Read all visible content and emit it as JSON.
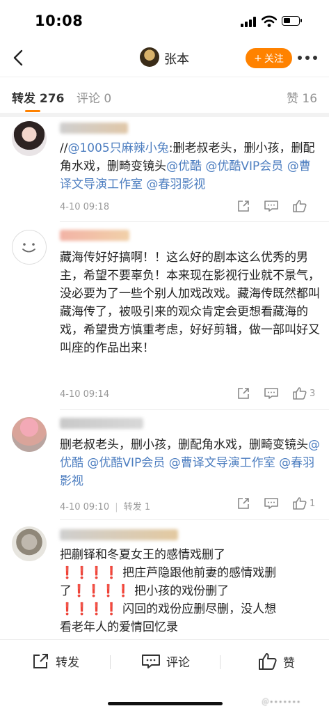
{
  "status": {
    "time": "10:08"
  },
  "nav": {
    "title": "张本",
    "follow_label": "关注"
  },
  "tabs": {
    "repost": "转发 276",
    "comment": "评论 0",
    "like": "赞 16"
  },
  "comments": [
    {
      "text_parts": [
        {
          "t": "//",
          "link": false
        },
        {
          "t": "@1005只麻辣小兔",
          "link": true
        },
        {
          "t": ":删老叔老头，删小孩，删配角水戏，删畸变镜头",
          "link": false
        },
        {
          "t": "@优酷",
          "link": true
        },
        {
          "t": " ",
          "link": false
        },
        {
          "t": "@优酷VIP会员",
          "link": true
        },
        {
          "t": " ",
          "link": false
        },
        {
          "t": "@曹译文导演工作室",
          "link": true
        },
        {
          "t": " ",
          "link": false
        },
        {
          "t": "@春羽影视",
          "link": true
        }
      ],
      "time": "4-10 09:18",
      "repost": "",
      "likes": ""
    },
    {
      "text_parts": [
        {
          "t": "藏海传好好搞啊！！这么好的剧本这么优秀的男主，希望不要辜负！本来现在影视行业就不景气，没必要为了一些个别人加戏改戏。藏海传既然都叫藏海传了，被吸引来的观众肯定会更想看藏海的戏，希望贵方慎重考虑，好好剪辑，做一部叫好又叫座的作品出来！",
          "link": false
        }
      ],
      "time": "4-10 09:14",
      "repost": "",
      "likes": "3"
    },
    {
      "text_parts": [
        {
          "t": "删老叔老头，删小孩，删配角水戏，删畸变镜头",
          "link": false
        },
        {
          "t": "@优酷",
          "link": true
        },
        {
          "t": " ",
          "link": false
        },
        {
          "t": "@优酷VIP会员",
          "link": true
        },
        {
          "t": " ",
          "link": false
        },
        {
          "t": "@曹译文导演工作室",
          "link": true
        },
        {
          "t": " ",
          "link": false
        },
        {
          "t": "@春羽影视",
          "link": true
        }
      ],
      "time": "4-10 09:10",
      "repost": "转发 1",
      "likes": "1"
    },
    {
      "lines": [
        "把蒯铎和冬夏女王的感情戏删了",
        "❗❗❗❗ 把庄芦隐跟他前妻的感情戏删",
        "了❗❗❗❗ 把小孩的戏份删了",
        "❗❗❗❗ 闪回的戏份应删尽删，没人想",
        "看老年人的爱情回忆录"
      ]
    }
  ],
  "bottom": {
    "repost": "转发",
    "comment": "评论",
    "like": "赞"
  },
  "icons": [
    "back-icon",
    "signal-icon",
    "wifi-icon",
    "battery-icon",
    "more-icon",
    "share-icon",
    "comment-icon",
    "like-icon"
  ],
  "colors": {
    "accent": "#ff8200",
    "link": "#4d7ec0",
    "meta": "#999999"
  }
}
